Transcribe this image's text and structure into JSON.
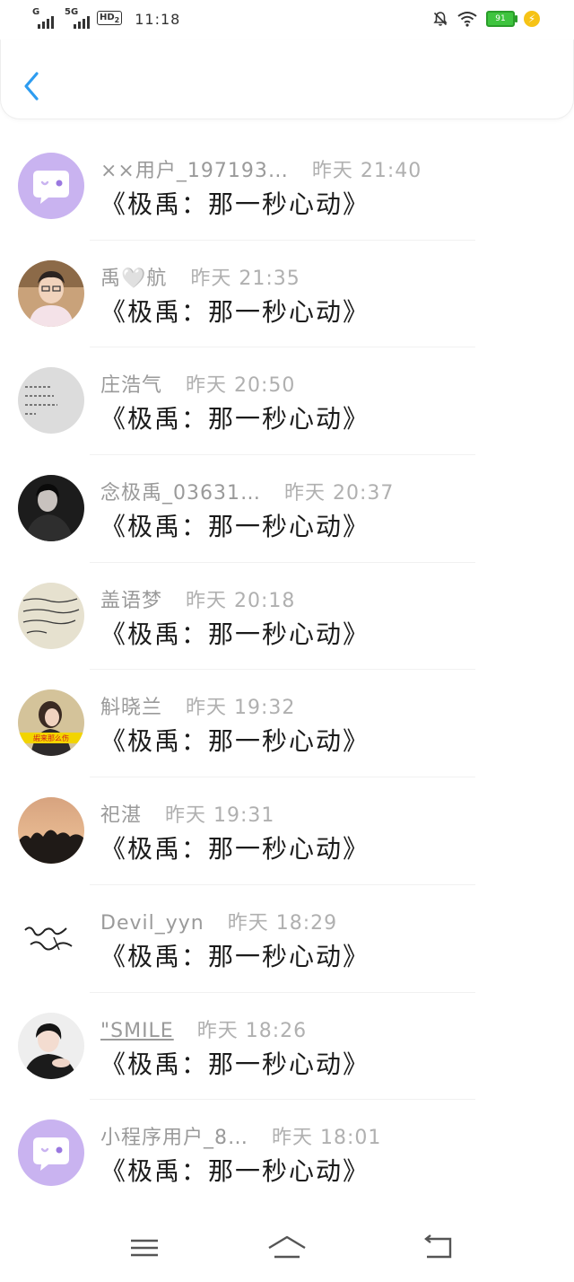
{
  "status_bar": {
    "signal1_label": "G",
    "signal2_label": "5G",
    "hd_label": "HD",
    "hd_sub": "2",
    "time": "11:18",
    "battery": "91"
  },
  "messages": [
    {
      "name": "××用户_197193…",
      "time": "昨天 21:40",
      "message": "《极禹：那一秒心动》",
      "avatar": "chat-bubble-avatar"
    },
    {
      "name": "禹🤍航",
      "time": "昨天 21:35",
      "message": "《极禹：那一秒心动》",
      "avatar": "photo-avatar"
    },
    {
      "name": "庄浩气",
      "time": "昨天 20:50",
      "message": "《极禹：那一秒心动》",
      "avatar": "text-image-avatar"
    },
    {
      "name": "念极禹_03631…",
      "time": "昨天 20:37",
      "message": "《极禹：那一秒心动》",
      "avatar": "photo-avatar"
    },
    {
      "name": "盖语梦",
      "time": "昨天 20:18",
      "message": "《极禹：那一秒心动》",
      "avatar": "handwriting-avatar"
    },
    {
      "name": "斛晓兰",
      "time": "昨天 19:32",
      "message": "《极禹：那一秒心动》",
      "avatar": "photo-avatar",
      "avatar_caption": "嘏来那么伤"
    },
    {
      "name": "祀湛",
      "time": "昨天 19:31",
      "message": "《极禹：那一秒心动》",
      "avatar": "sunset-avatar"
    },
    {
      "name": "Devil_yyn",
      "time": "昨天 18:29",
      "message": "《极禹：那一秒心动》",
      "avatar": "calligraphy-avatar"
    },
    {
      "name": "\"SMILE",
      "time": "昨天 18:26",
      "message": "《极禹：那一秒心动》",
      "avatar": "photo-avatar"
    },
    {
      "name": "小程序用户_8…",
      "time": "昨天 18:01",
      "message": "《极禹：那一秒心动》",
      "avatar": "chat-bubble-avatar"
    }
  ],
  "colors": {
    "back_arrow": "#2d9cf0",
    "bubble_avatar_bg": "#c9b3f0",
    "name_gray": "#9a9a9a"
  }
}
